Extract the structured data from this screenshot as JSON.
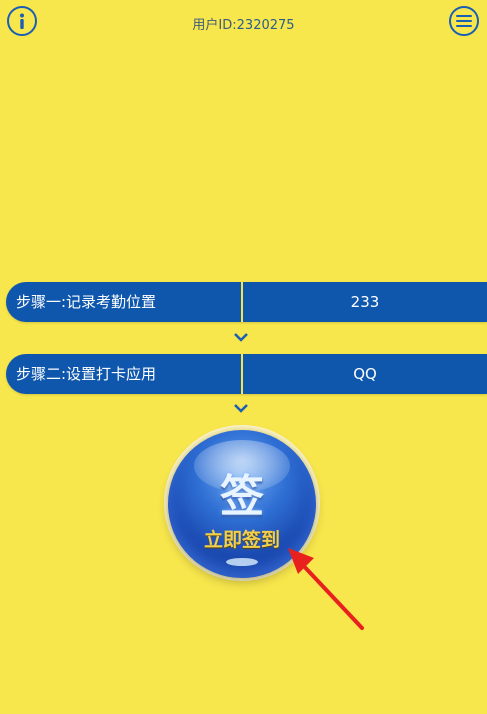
{
  "header": {
    "user_prefix": "用户ID:",
    "user_id": "2320275"
  },
  "steps": [
    {
      "label": "步骤一:记录考勤位置",
      "value": "233"
    },
    {
      "label": "步骤二:设置打卡应用",
      "value": "QQ"
    }
  ],
  "sign_button": {
    "glyph": "签",
    "label": "立即签到"
  },
  "colors": {
    "background": "#f7e64c",
    "bar": "#0f57ad",
    "icon": "#1a5fb4",
    "arrow": "#e8201e"
  },
  "icons": {
    "top_left": "info-icon",
    "top_right": "menu-icon",
    "separator": "chevron-down-icon"
  }
}
